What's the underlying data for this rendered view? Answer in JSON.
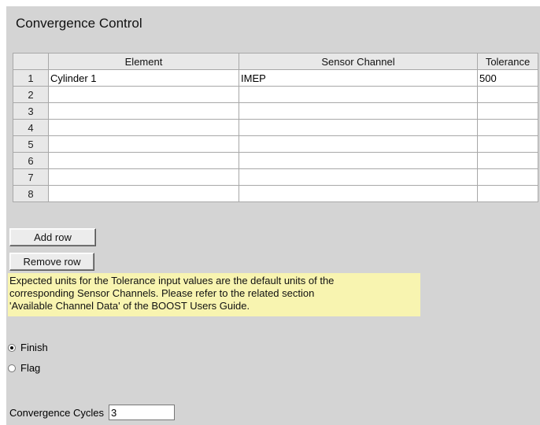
{
  "title": "Convergence Control",
  "table": {
    "headers": [
      "Element",
      "Sensor Channel",
      "Tolerance"
    ],
    "rows": [
      {
        "num": "1",
        "element": "Cylinder 1",
        "sensor": "IMEP",
        "tolerance": "500"
      },
      {
        "num": "2",
        "element": "",
        "sensor": "",
        "tolerance": ""
      },
      {
        "num": "3",
        "element": "",
        "sensor": "",
        "tolerance": ""
      },
      {
        "num": "4",
        "element": "",
        "sensor": "",
        "tolerance": ""
      },
      {
        "num": "5",
        "element": "",
        "sensor": "",
        "tolerance": ""
      },
      {
        "num": "6",
        "element": "",
        "sensor": "",
        "tolerance": ""
      },
      {
        "num": "7",
        "element": "",
        "sensor": "",
        "tolerance": ""
      },
      {
        "num": "8",
        "element": "",
        "sensor": "",
        "tolerance": ""
      }
    ]
  },
  "buttons": {
    "add_row": "Add row",
    "remove_row": "Remove row"
  },
  "note": {
    "lines": [
      "Expected units for the Tolerance input values are the default units of the",
      "corresponding Sensor Channels. Please refer to the related section",
      "'Available Channel Data' of the BOOST Users Guide."
    ]
  },
  "options": {
    "selected": "Finish",
    "finish_label": "Finish",
    "flag_label": "Flag"
  },
  "cycles": {
    "label": "Convergence Cycles",
    "value": "3"
  },
  "colors": {
    "panel_background": "#d4d4d4",
    "note_background": "#f8f4b0",
    "header_background": "#e8e8e8"
  }
}
